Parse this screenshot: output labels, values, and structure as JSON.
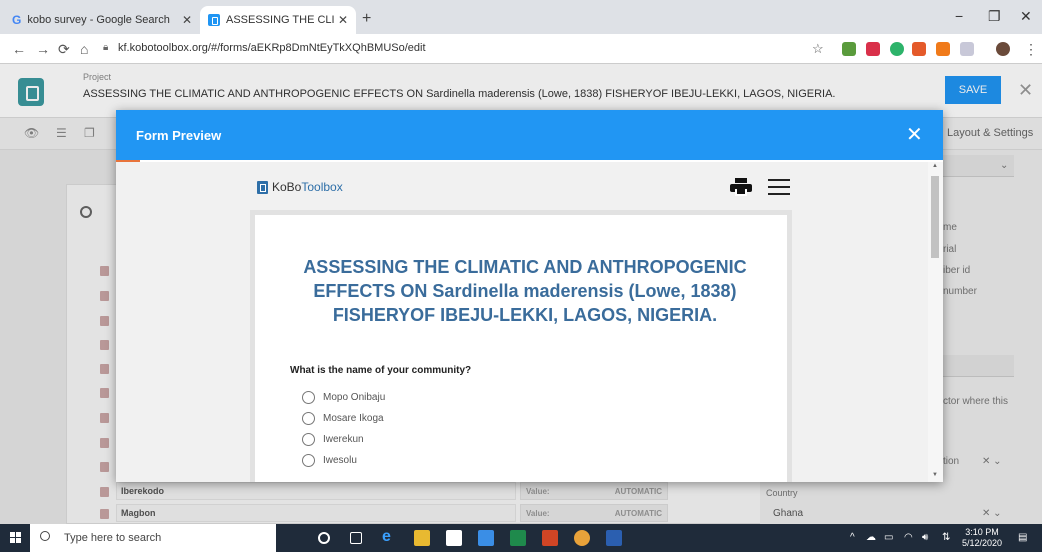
{
  "browser": {
    "tabs": [
      {
        "label": "kobo survey - Google Search",
        "icon": "google-icon"
      },
      {
        "label": "ASSESSING THE CLIMATIC AND A",
        "icon": "kobo-icon"
      }
    ],
    "new_tab": "+",
    "url": "kf.kobotoolbox.org/#/forms/aEKRp8DmNtEyTkXQhBMUSo/edit",
    "window_controls": {
      "minimize": "−",
      "maximize": "❐",
      "close": "✕"
    }
  },
  "app": {
    "project_label": "Project",
    "project_title": "ASSESSING THE CLIMATIC AND ANTHROPOGENIC EFFECTS ON Sardinella maderensis (Lowe, 1838) FISHERYOF IBEJU-LEKKI, LAGOS, NIGERIA.",
    "save_label": "SAVE",
    "layout_settings": "Layout & Settings"
  },
  "builder": {
    "rows": [
      {
        "name": "Iberekodo",
        "value_label": "Value:",
        "value": "AUTOMATIC"
      },
      {
        "name": "Magbon",
        "value_label": "Value:",
        "value": "AUTOMATIC"
      }
    ]
  },
  "sidepanel": {
    "items": [
      "me",
      "rial",
      "iber id",
      "number"
    ],
    "hint": "ctor where this",
    "tion_field": "tion",
    "country_label": "Country",
    "country_value": "Ghana"
  },
  "modal": {
    "title": "Form Preview",
    "logo_text_1": "KoBo",
    "logo_text_2": "Toolbox",
    "form_title": "ASSESSING THE CLIMATIC AND ANTHROPOGENIC EFFECTS ON Sardinella maderensis (Lowe, 1838) FISHERYOF IBEJU-LEKKI, LAGOS, NIGERIA.",
    "question": "What is the name of your community?",
    "options": [
      "Mopo Onibaju",
      "Mosare Ikoga",
      "Iwerekun",
      "Iwesolu"
    ]
  },
  "taskbar": {
    "search_placeholder": "Type here to search",
    "time": "3:10 PM",
    "date": "5/12/2020"
  },
  "colors": {
    "accent": "#2196f3",
    "title_blue": "#3a6c9b",
    "taskbar": "#1f2b3a"
  }
}
